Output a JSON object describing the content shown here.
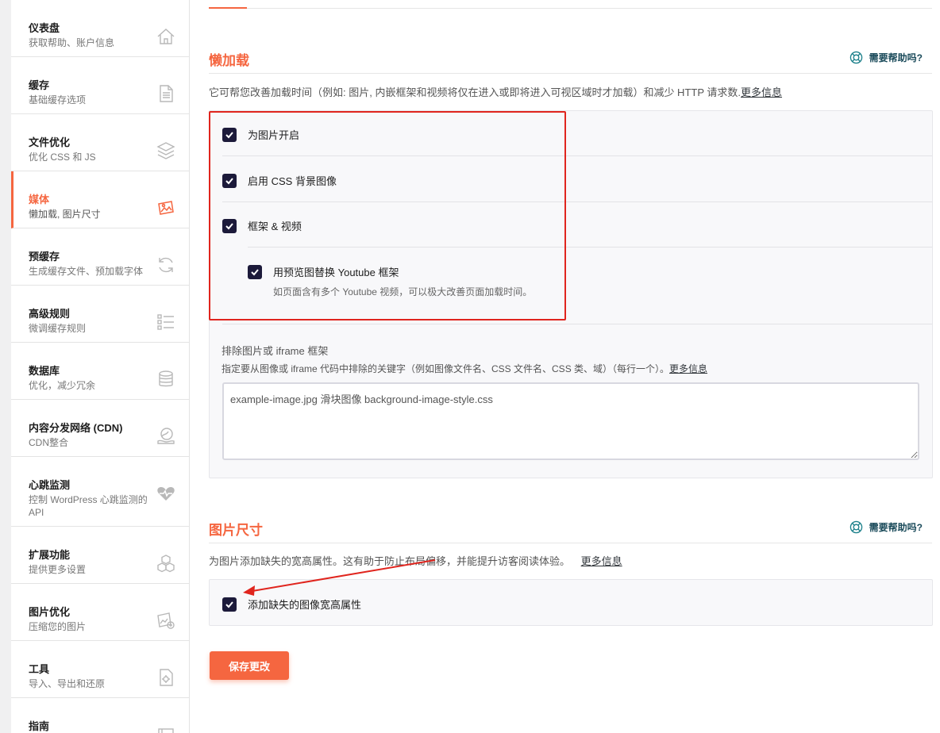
{
  "sidebar": {
    "items": [
      {
        "title": "仪表盘",
        "subtitle": "获取帮助、账户信息",
        "icon": "home-icon"
      },
      {
        "title": "缓存",
        "subtitle": "基础缓存选项",
        "icon": "file-icon"
      },
      {
        "title": "文件优化",
        "subtitle": "优化 CSS 和 JS",
        "icon": "layers-icon"
      },
      {
        "title": "媒体",
        "subtitle": "懒加载, 图片尺寸",
        "icon": "images-icon"
      },
      {
        "title": "预缓存",
        "subtitle": "生成缓存文件、预加载字体",
        "icon": "refresh-icon"
      },
      {
        "title": "高级规则",
        "subtitle": "微调缓存规则",
        "icon": "list-icon"
      },
      {
        "title": "数据库",
        "subtitle": "优化，减少冗余",
        "icon": "database-icon"
      },
      {
        "title": "内容分发网络 (CDN)",
        "subtitle": "CDN整合",
        "icon": "cdn-icon"
      },
      {
        "title": "心跳监测",
        "subtitle": "控制 WordPress 心跳监测的 API",
        "icon": "heartbeat-icon"
      },
      {
        "title": "扩展功能",
        "subtitle": "提供更多设置",
        "icon": "cubes-icon"
      },
      {
        "title": "图片优化",
        "subtitle": "压缩您的图片",
        "icon": "image-optimize-icon"
      },
      {
        "title": "工具",
        "subtitle": "导入、导出和还原",
        "icon": "tools-icon"
      },
      {
        "title": "指南",
        "subtitle": "",
        "icon": "guide-icon"
      }
    ]
  },
  "lazyload": {
    "title": "懒加载",
    "help_label": "需要帮助吗?",
    "description": "它可帮您改善加载时间（例如: 图片, 内嵌框架和视频将仅在进入或即将进入可视区域时才加载）和减少 HTTP 请求数.",
    "more_info": "更多信息",
    "options": {
      "images": {
        "label": "为图片开启",
        "checked": true
      },
      "css_bg": {
        "label": "启用 CSS 背景图像",
        "checked": true
      },
      "iframes": {
        "label": "框架 & 视频",
        "checked": true
      },
      "youtube": {
        "label": "用预览图替换 Youtube 框架",
        "description": "如页面含有多个 Youtube 视频，可以极大改善页面加载时间。",
        "checked": true
      }
    },
    "exclude": {
      "label": "排除图片或 iframe 框架",
      "description": "指定要从图像或 iframe 代码中排除的关键字（例如图像文件名、CSS 文件名、CSS 类、域）（每行一个）。",
      "more_info": "更多信息",
      "value": "example-image.jpg 滑块图像 background-image-style.css"
    }
  },
  "dimensions": {
    "title": "图片尺寸",
    "help_label": "需要帮助吗?",
    "description": "为图片添加缺失的宽高属性。这有助于防止布局偏移，并能提升访客阅读体验。",
    "more_info": "更多信息",
    "option": {
      "label": "添加缺失的图像宽高属性",
      "checked": true
    }
  },
  "save_button": "保存更改",
  "colors": {
    "accent": "#f56640",
    "checkbox": "#1c1a3a",
    "annotation_red": "#e0251e"
  }
}
